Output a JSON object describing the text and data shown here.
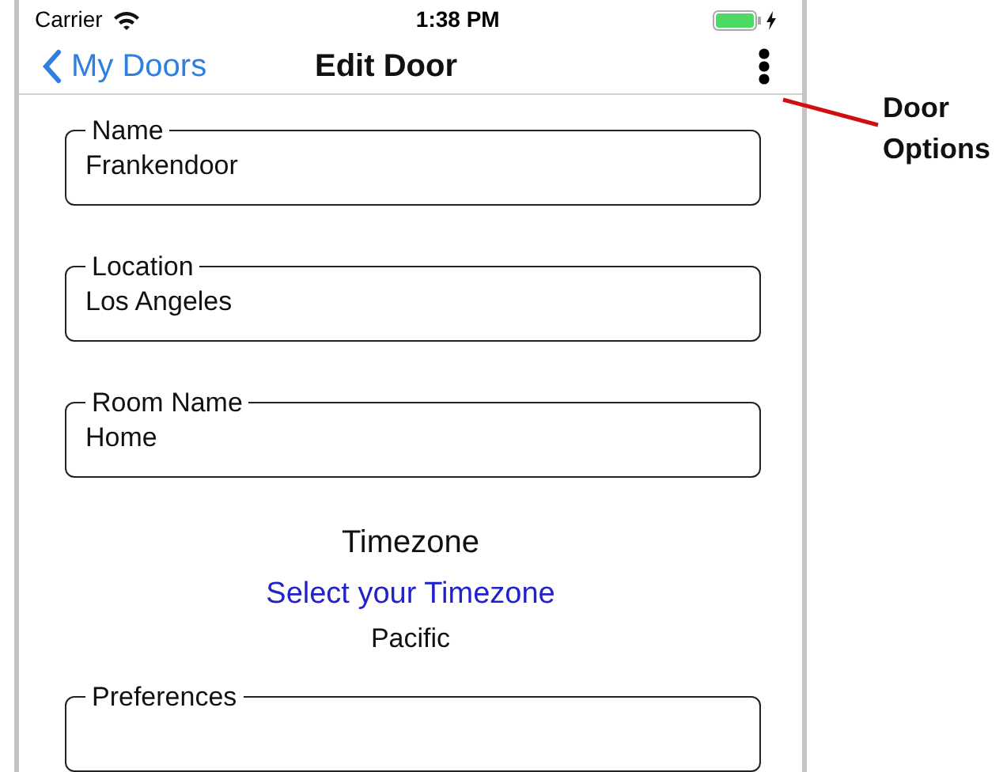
{
  "status_bar": {
    "carrier": "Carrier",
    "time": "1:38 PM",
    "battery_charging": true
  },
  "nav_bar": {
    "back": "My Doors",
    "title": "Edit Door"
  },
  "fields": [
    {
      "label": "Name",
      "value": "Frankendoor"
    },
    {
      "label": "Location",
      "value": "Los Angeles"
    },
    {
      "label": "Room Name",
      "value": "Home"
    }
  ],
  "timezone": {
    "heading": "Timezone",
    "link": "Select your Timezone",
    "value": "Pacific"
  },
  "preferences": {
    "label": "Preferences"
  },
  "annotation": {
    "text": "Door Options"
  }
}
